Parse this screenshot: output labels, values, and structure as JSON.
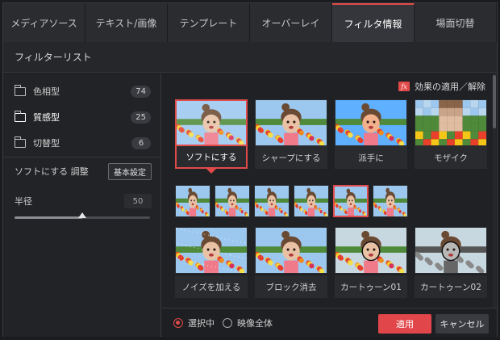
{
  "tabs": [
    {
      "label": "メディアソース",
      "active": false
    },
    {
      "label": "テキスト/画像",
      "active": false
    },
    {
      "label": "テンプレート",
      "active": false
    },
    {
      "label": "オーバーレイ",
      "active": false
    },
    {
      "label": "フィルタ情報",
      "active": true
    },
    {
      "label": "場面切替",
      "active": false
    }
  ],
  "filter_list": {
    "title": "フィルターリスト"
  },
  "categories": [
    {
      "label": "色相型",
      "count": "74",
      "icon": "folder-icon"
    },
    {
      "label": "質感型",
      "count": "25",
      "icon": "folder-open-icon"
    },
    {
      "label": "切替型",
      "count": "6",
      "icon": "folder-icon"
    }
  ],
  "adjust": {
    "label": "ソフトにする 調整",
    "basic_button": "基本設定"
  },
  "radius": {
    "label": "半径",
    "value": "50",
    "slider_fraction": 0.5
  },
  "apply_effect": {
    "label": "効果の適用／解除",
    "icon_text": "fx"
  },
  "filters_row1": [
    {
      "label": "ソフトにする",
      "selected": true,
      "style": "soft"
    },
    {
      "label": "シャープにする",
      "selected": false,
      "style": "sharp"
    },
    {
      "label": "派手に",
      "selected": false,
      "style": "vivid"
    },
    {
      "label": "モザイク",
      "selected": false,
      "style": "mosaic"
    }
  ],
  "variants": [
    {
      "selected": false
    },
    {
      "selected": false
    },
    {
      "selected": false
    },
    {
      "selected": false
    },
    {
      "selected": true
    },
    {
      "selected": false
    }
  ],
  "filters_row2": [
    {
      "label": "ノイズを加える",
      "style": "noise"
    },
    {
      "label": "ブロック消去",
      "style": "block"
    },
    {
      "label": "カートゥーン01",
      "style": "cartoon1"
    },
    {
      "label": "カートゥーン02",
      "style": "cartoon2"
    }
  ],
  "footer": {
    "radio_selected": "選択中",
    "radio_whole": "映像全体",
    "apply_button": "適用",
    "cancel_button": "キャンセル"
  },
  "colors": {
    "accent": "#e14a4a",
    "background": "#202124"
  }
}
